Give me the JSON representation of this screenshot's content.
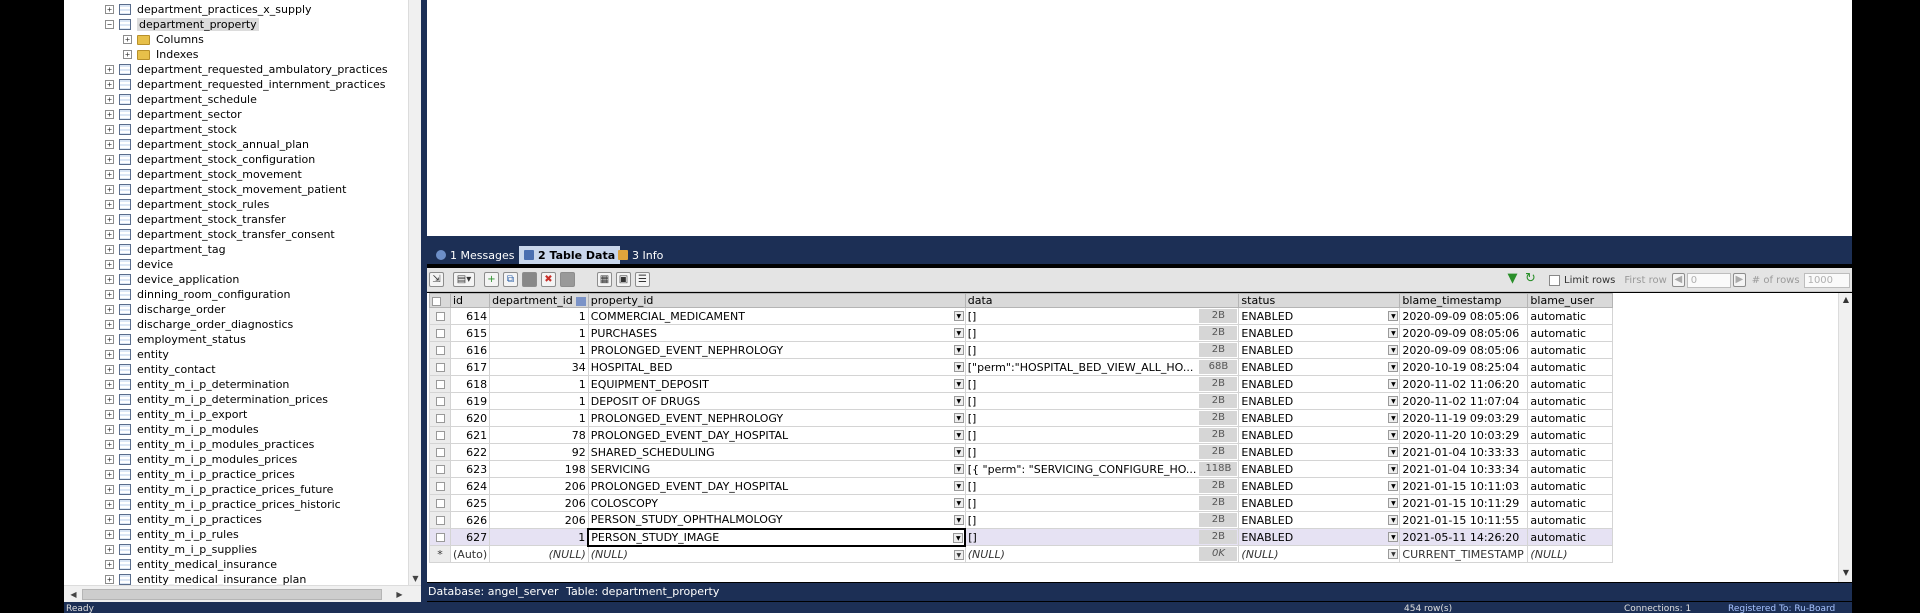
{
  "tree": {
    "items": [
      {
        "label": "department_practices_x_supply",
        "expander": "+",
        "icon": "table-icon",
        "indent": 0
      },
      {
        "label": "department_property",
        "expander": "−",
        "icon": "table-icon",
        "indent": 0,
        "selected": true
      },
      {
        "label": "Columns",
        "expander": "+",
        "icon": "folder-icon",
        "indent": 1
      },
      {
        "label": "Indexes",
        "expander": "+",
        "icon": "folder-icon",
        "indent": 1
      },
      {
        "label": "department_requested_ambulatory_practices",
        "expander": "+",
        "icon": "table-icon",
        "indent": 0
      },
      {
        "label": "department_requested_internment_practices",
        "expander": "+",
        "icon": "table-icon",
        "indent": 0
      },
      {
        "label": "department_schedule",
        "expander": "+",
        "icon": "table-icon",
        "indent": 0
      },
      {
        "label": "department_sector",
        "expander": "+",
        "icon": "table-icon",
        "indent": 0
      },
      {
        "label": "department_stock",
        "expander": "+",
        "icon": "table-icon",
        "indent": 0
      },
      {
        "label": "department_stock_annual_plan",
        "expander": "+",
        "icon": "table-icon",
        "indent": 0
      },
      {
        "label": "department_stock_configuration",
        "expander": "+",
        "icon": "table-icon",
        "indent": 0
      },
      {
        "label": "department_stock_movement",
        "expander": "+",
        "icon": "table-icon",
        "indent": 0
      },
      {
        "label": "department_stock_movement_patient",
        "expander": "+",
        "icon": "table-icon",
        "indent": 0
      },
      {
        "label": "department_stock_rules",
        "expander": "+",
        "icon": "table-icon",
        "indent": 0
      },
      {
        "label": "department_stock_transfer",
        "expander": "+",
        "icon": "table-icon",
        "indent": 0
      },
      {
        "label": "department_stock_transfer_consent",
        "expander": "+",
        "icon": "table-icon",
        "indent": 0
      },
      {
        "label": "department_tag",
        "expander": "+",
        "icon": "table-icon",
        "indent": 0
      },
      {
        "label": "device",
        "expander": "+",
        "icon": "table-icon",
        "indent": 0
      },
      {
        "label": "device_application",
        "expander": "+",
        "icon": "table-icon",
        "indent": 0
      },
      {
        "label": "dinning_room_configuration",
        "expander": "+",
        "icon": "table-icon",
        "indent": 0
      },
      {
        "label": "discharge_order",
        "expander": "+",
        "icon": "table-icon",
        "indent": 0
      },
      {
        "label": "discharge_order_diagnostics",
        "expander": "+",
        "icon": "table-icon",
        "indent": 0
      },
      {
        "label": "employment_status",
        "expander": "+",
        "icon": "table-icon",
        "indent": 0
      },
      {
        "label": "entity",
        "expander": "+",
        "icon": "table-icon",
        "indent": 0
      },
      {
        "label": "entity_contact",
        "expander": "+",
        "icon": "table-icon",
        "indent": 0
      },
      {
        "label": "entity_m_i_p_determination",
        "expander": "+",
        "icon": "table-icon",
        "indent": 0
      },
      {
        "label": "entity_m_i_p_determination_prices",
        "expander": "+",
        "icon": "table-icon",
        "indent": 0
      },
      {
        "label": "entity_m_i_p_export",
        "expander": "+",
        "icon": "table-icon",
        "indent": 0
      },
      {
        "label": "entity_m_i_p_modules",
        "expander": "+",
        "icon": "table-icon",
        "indent": 0
      },
      {
        "label": "entity_m_i_p_modules_practices",
        "expander": "+",
        "icon": "table-icon",
        "indent": 0
      },
      {
        "label": "entity_m_i_p_modules_prices",
        "expander": "+",
        "icon": "table-icon",
        "indent": 0
      },
      {
        "label": "entity_m_i_p_practice_prices",
        "expander": "+",
        "icon": "table-icon",
        "indent": 0
      },
      {
        "label": "entity_m_i_p_practice_prices_future",
        "expander": "+",
        "icon": "table-icon",
        "indent": 0
      },
      {
        "label": "entity_m_i_p_practice_prices_historic",
        "expander": "+",
        "icon": "table-icon",
        "indent": 0
      },
      {
        "label": "entity_m_i_p_practices",
        "expander": "+",
        "icon": "table-icon",
        "indent": 0
      },
      {
        "label": "entity_m_i_p_rules",
        "expander": "+",
        "icon": "table-icon",
        "indent": 0
      },
      {
        "label": "entity_m_i_p_supplies",
        "expander": "+",
        "icon": "table-icon",
        "indent": 0
      },
      {
        "label": "entity_medical_insurance",
        "expander": "+",
        "icon": "table-icon",
        "indent": 0
      },
      {
        "label": "entity_medical_insurance_plan",
        "expander": "+",
        "icon": "table-icon",
        "indent": 0
      }
    ]
  },
  "result_tabs": [
    {
      "label": "1 Messages",
      "icon": "info-icon",
      "active": false
    },
    {
      "label": "2 Table Data",
      "icon": "table-icon",
      "active": true
    },
    {
      "label": "3 Info",
      "icon": "chart-icon",
      "active": false
    }
  ],
  "toolbar": {
    "limit_rows_label": "Limit rows",
    "first_row_label": "First row",
    "first_row_value": "0",
    "num_rows_label": "# of rows",
    "num_rows_value": "1000"
  },
  "grid": {
    "columns": [
      "id",
      "department_id",
      "property_id",
      "data",
      "status",
      "blame_timestamp",
      "blame_user"
    ],
    "rows": [
      {
        "id": "614",
        "department_id": "1",
        "property_id": "COMMERCIAL_MEDICAMENT",
        "data": "[]",
        "size": "2B",
        "status": "ENABLED",
        "blame_timestamp": "2020-09-09 08:05:06",
        "blame_user": "automatic"
      },
      {
        "id": "615",
        "department_id": "1",
        "property_id": "PURCHASES",
        "data": "[]",
        "size": "2B",
        "status": "ENABLED",
        "blame_timestamp": "2020-09-09 08:05:06",
        "blame_user": "automatic"
      },
      {
        "id": "616",
        "department_id": "1",
        "property_id": "PROLONGED_EVENT_NEPHROLOGY",
        "data": "[]",
        "size": "2B",
        "status": "ENABLED",
        "blame_timestamp": "2020-09-09 08:05:06",
        "blame_user": "automatic"
      },
      {
        "id": "617",
        "department_id": "34",
        "property_id": "HOSPITAL_BED",
        "data": "[\"perm\":\"HOSPITAL_BED_VIEW_ALL_HO...",
        "size": "68B",
        "status": "ENABLED",
        "blame_timestamp": "2020-10-19 08:25:04",
        "blame_user": "automatic"
      },
      {
        "id": "618",
        "department_id": "1",
        "property_id": "EQUIPMENT_DEPOSIT",
        "data": "[]",
        "size": "2B",
        "status": "ENABLED",
        "blame_timestamp": "2020-11-02 11:06:20",
        "blame_user": "automatic"
      },
      {
        "id": "619",
        "department_id": "1",
        "property_id": "DEPOSIT OF DRUGS",
        "data": "[]",
        "size": "2B",
        "status": "ENABLED",
        "blame_timestamp": "2020-11-02 11:07:04",
        "blame_user": "automatic"
      },
      {
        "id": "620",
        "department_id": "1",
        "property_id": "PROLONGED_EVENT_NEPHROLOGY",
        "data": "[]",
        "size": "2B",
        "status": "ENABLED",
        "blame_timestamp": "2020-11-19 09:03:29",
        "blame_user": "automatic"
      },
      {
        "id": "621",
        "department_id": "78",
        "property_id": "PROLONGED_EVENT_DAY_HOSPITAL",
        "data": "[]",
        "size": "2B",
        "status": "ENABLED",
        "blame_timestamp": "2020-11-20 10:03:29",
        "blame_user": "automatic"
      },
      {
        "id": "622",
        "department_id": "92",
        "property_id": "SHARED_SCHEDULING",
        "data": "[]",
        "size": "2B",
        "status": "ENABLED",
        "blame_timestamp": "2021-01-04 10:33:33",
        "blame_user": "automatic"
      },
      {
        "id": "623",
        "department_id": "198",
        "property_id": "SERVICING",
        "data": "[{ \"perm\": \"SERVICING_CONFIGURE_HO...",
        "size": "118B",
        "status": "ENABLED",
        "blame_timestamp": "2021-01-04 10:33:34",
        "blame_user": "automatic"
      },
      {
        "id": "624",
        "department_id": "206",
        "property_id": "PROLONGED_EVENT_DAY_HOSPITAL",
        "data": "[]",
        "size": "2B",
        "status": "ENABLED",
        "blame_timestamp": "2021-01-15 10:11:03",
        "blame_user": "automatic"
      },
      {
        "id": "625",
        "department_id": "206",
        "property_id": "COLOSCOPY",
        "data": "[]",
        "size": "2B",
        "status": "ENABLED",
        "blame_timestamp": "2021-01-15 10:11:29",
        "blame_user": "automatic"
      },
      {
        "id": "626",
        "department_id": "206",
        "property_id": "PERSON_STUDY_OPHTHALMOLOGY",
        "data": "[]",
        "size": "2B",
        "status": "ENABLED",
        "blame_timestamp": "2021-01-15 10:11:55",
        "blame_user": "automatic"
      },
      {
        "id": "627",
        "department_id": "1",
        "property_id": "PERSON_STUDY_IMAGE",
        "data": "[]",
        "size": "2B",
        "status": "ENABLED",
        "blame_timestamp": "2021-05-11 14:26:20",
        "blame_user": "automatic",
        "current": true
      }
    ],
    "new_row": {
      "marker": "*",
      "id": "(Auto)",
      "department_id": "(NULL)",
      "property_id": "(NULL)",
      "data": "(NULL)",
      "size": "0K",
      "status": "(NULL)",
      "blame_timestamp": "CURRENT_TIMESTAMP",
      "blame_user": "(NULL)"
    }
  },
  "db_bar": {
    "database_label": "Database:",
    "database_value": "angel_server",
    "table_label": "Table:",
    "table_value": "department_property"
  },
  "status_bar": {
    "ready": "Ready",
    "rows": "454 row(s)",
    "connections": "Connections: 1",
    "registered": "Registered To: Ru-Board"
  },
  "colors": {
    "frame": "#1c2f55",
    "selected_row": "#e6e2f3"
  }
}
